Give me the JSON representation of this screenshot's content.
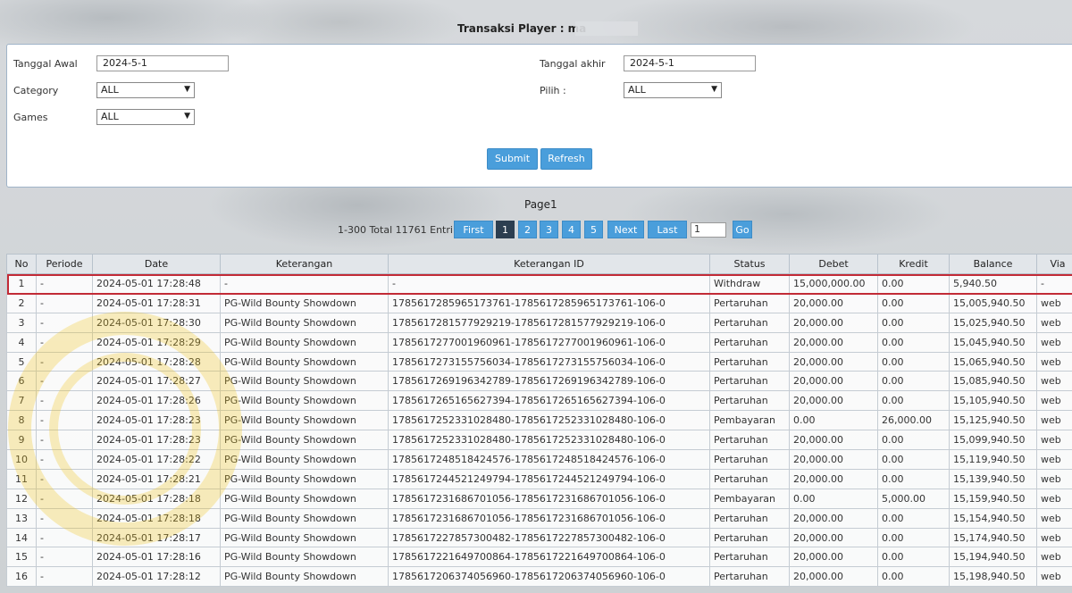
{
  "header": {
    "title": "Transaksi",
    "player_label": "Player : ma"
  },
  "filters": {
    "tanggal_awal_label": "Tanggal Awal",
    "tanggal_awal_value": "2024-5-1",
    "tanggal_akhir_label": "Tanggal akhir",
    "tanggal_akhir_value": "2024-5-1",
    "category_label": "Category",
    "category_value": "ALL",
    "pilih_label": "Pilih  :",
    "pilih_value": "ALL",
    "games_label": "Games",
    "games_value": "ALL",
    "submit_label": "Submit",
    "refresh_label": "Refresh"
  },
  "pagination": {
    "page_title": "Page1",
    "range_text": "1-300 Total 11761 Entri",
    "first_label": "First",
    "pages": [
      "1",
      "2",
      "3",
      "4",
      "5"
    ],
    "next_label": "Next",
    "last_label": "Last",
    "page_input_value": "1",
    "go_label": "Go"
  },
  "table": {
    "headers": [
      "No",
      "Periode",
      "Date",
      "Keterangan",
      "Keterangan ID",
      "Status",
      "Debet",
      "Kredit",
      "Balance",
      "Via"
    ],
    "rows": [
      [
        "1",
        "-",
        "2024-05-01 17:28:48",
        "-",
        "-",
        "Withdraw",
        "15,000,000.00",
        "0.00",
        "5,940.50",
        "-"
      ],
      [
        "2",
        "-",
        "2024-05-01 17:28:31",
        "PG-Wild Bounty Showdown",
        "1785617285965173761-1785617285965173761-106-0",
        "Pertaruhan",
        "20,000.00",
        "0.00",
        "15,005,940.50",
        "web"
      ],
      [
        "3",
        "-",
        "2024-05-01 17:28:30",
        "PG-Wild Bounty Showdown",
        "1785617281577929219-1785617281577929219-106-0",
        "Pertaruhan",
        "20,000.00",
        "0.00",
        "15,025,940.50",
        "web"
      ],
      [
        "4",
        "-",
        "2024-05-01 17:28:29",
        "PG-Wild Bounty Showdown",
        "1785617277001960961-1785617277001960961-106-0",
        "Pertaruhan",
        "20,000.00",
        "0.00",
        "15,045,940.50",
        "web"
      ],
      [
        "5",
        "-",
        "2024-05-01 17:28:28",
        "PG-Wild Bounty Showdown",
        "1785617273155756034-1785617273155756034-106-0",
        "Pertaruhan",
        "20,000.00",
        "0.00",
        "15,065,940.50",
        "web"
      ],
      [
        "6",
        "-",
        "2024-05-01 17:28:27",
        "PG-Wild Bounty Showdown",
        "1785617269196342789-1785617269196342789-106-0",
        "Pertaruhan",
        "20,000.00",
        "0.00",
        "15,085,940.50",
        "web"
      ],
      [
        "7",
        "-",
        "2024-05-01 17:28:26",
        "PG-Wild Bounty Showdown",
        "1785617265165627394-1785617265165627394-106-0",
        "Pertaruhan",
        "20,000.00",
        "0.00",
        "15,105,940.50",
        "web"
      ],
      [
        "8",
        "-",
        "2024-05-01 17:28:23",
        "PG-Wild Bounty Showdown",
        "1785617252331028480-1785617252331028480-106-0",
        "Pembayaran",
        "0.00",
        "26,000.00",
        "15,125,940.50",
        "web"
      ],
      [
        "9",
        "-",
        "2024-05-01 17:28:23",
        "PG-Wild Bounty Showdown",
        "1785617252331028480-1785617252331028480-106-0",
        "Pertaruhan",
        "20,000.00",
        "0.00",
        "15,099,940.50",
        "web"
      ],
      [
        "10",
        "-",
        "2024-05-01 17:28:22",
        "PG-Wild Bounty Showdown",
        "1785617248518424576-1785617248518424576-106-0",
        "Pertaruhan",
        "20,000.00",
        "0.00",
        "15,119,940.50",
        "web"
      ],
      [
        "11",
        "-",
        "2024-05-01 17:28:21",
        "PG-Wild Bounty Showdown",
        "1785617244521249794-1785617244521249794-106-0",
        "Pertaruhan",
        "20,000.00",
        "0.00",
        "15,139,940.50",
        "web"
      ],
      [
        "12",
        "-",
        "2024-05-01 17:28:18",
        "PG-Wild Bounty Showdown",
        "1785617231686701056-1785617231686701056-106-0",
        "Pembayaran",
        "0.00",
        "5,000.00",
        "15,159,940.50",
        "web"
      ],
      [
        "13",
        "-",
        "2024-05-01 17:28:18",
        "PG-Wild Bounty Showdown",
        "1785617231686701056-1785617231686701056-106-0",
        "Pertaruhan",
        "20,000.00",
        "0.00",
        "15,154,940.50",
        "web"
      ],
      [
        "14",
        "-",
        "2024-05-01 17:28:17",
        "PG-Wild Bounty Showdown",
        "1785617227857300482-1785617227857300482-106-0",
        "Pertaruhan",
        "20,000.00",
        "0.00",
        "15,174,940.50",
        "web"
      ],
      [
        "15",
        "-",
        "2024-05-01 17:28:16",
        "PG-Wild Bounty Showdown",
        "1785617221649700864-1785617221649700864-106-0",
        "Pertaruhan",
        "20,000.00",
        "0.00",
        "15,194,940.50",
        "web"
      ],
      [
        "16",
        "-",
        "2024-05-01 17:28:12",
        "PG-Wild Bounty Showdown",
        "1785617206374056960-1785617206374056960-106-0",
        "Pertaruhan",
        "20,000.00",
        "0.00",
        "15,198,940.50",
        "web"
      ]
    ]
  },
  "colors": {
    "accent": "#4a9edb",
    "active_page": "#2c3e50",
    "highlight": "#c22a36",
    "negative": "#d9222a"
  }
}
